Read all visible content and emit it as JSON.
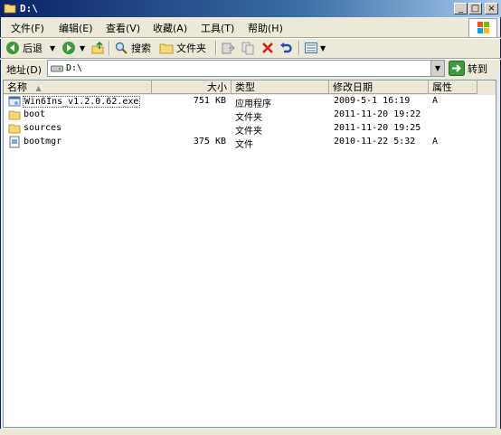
{
  "window": {
    "title": "D:\\"
  },
  "title_buttons": {
    "minimize": "_",
    "maximize": "□",
    "close": "×"
  },
  "menu": [
    "文件(F)",
    "编辑(E)",
    "查看(V)",
    "收藏(A)",
    "工具(T)",
    "帮助(H)"
  ],
  "toolbar": {
    "back_label": "后退",
    "search_label": "搜索",
    "folders_label": "文件夹"
  },
  "address": {
    "label": "地址(D)",
    "value": "D:\\",
    "go_label": "转到"
  },
  "columns": {
    "name": "名称",
    "size": "大小",
    "type": "类型",
    "modified": "修改日期",
    "attributes": "属性"
  },
  "files": [
    {
      "name": "Win6Ins_v1.2.0.62.exe",
      "size": "751 KB",
      "type": "应用程序",
      "modified": "2009-5-1 16:19",
      "attributes": "A",
      "icon": "exe-icon"
    },
    {
      "name": "boot",
      "size": "",
      "type": "文件夹",
      "modified": "2011-11-20 19:22",
      "attributes": "",
      "icon": "folder-icon"
    },
    {
      "name": "sources",
      "size": "",
      "type": "文件夹",
      "modified": "2011-11-20 19:25",
      "attributes": "",
      "icon": "folder-icon"
    },
    {
      "name": "bootmgr",
      "size": "375 KB",
      "type": "文件",
      "modified": "2010-11-22 5:32",
      "attributes": "A",
      "icon": "file-icon"
    }
  ],
  "colors": {
    "titlebar": "#0a246a",
    "chrome": "#ece9d8",
    "folder": "#f7d774"
  }
}
